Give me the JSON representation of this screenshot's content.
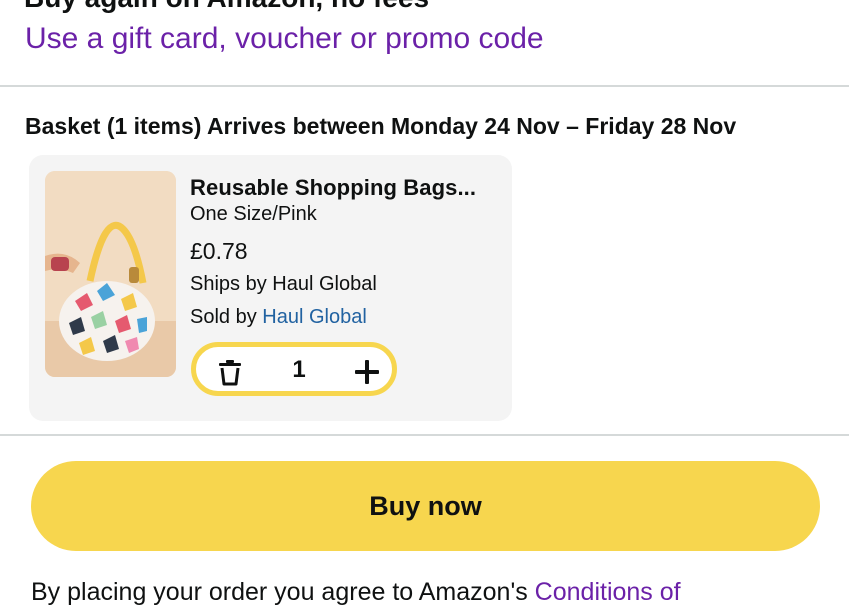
{
  "payment": {
    "heading_partial": "Buy again on Amazon, no fees",
    "gift_card_link": "Use a gift card, voucher or promo code"
  },
  "basket": {
    "header": "Basket (1 items) Arrives between Monday 24 Nov – Friday 28 Nov",
    "item": {
      "title": "Reusable Shopping Bags...",
      "variant": "One Size/Pink",
      "price": "£0.78",
      "ships_by": "Ships by Haul Global",
      "sold_by_prefix": "Sold by ",
      "seller": "Haul Global",
      "quantity": "1",
      "image_icon": "product-image"
    }
  },
  "actions": {
    "buy_now": "Buy now"
  },
  "legal": {
    "prefix": "By placing your order you agree to Amazon's ",
    "link": "Conditions of"
  },
  "colors": {
    "accent_yellow": "#f7d64e",
    "link_purple": "#6b21a8",
    "link_blue": "#2162a1",
    "card_bg": "#f4f4f4",
    "divider": "#d5d9d9"
  }
}
